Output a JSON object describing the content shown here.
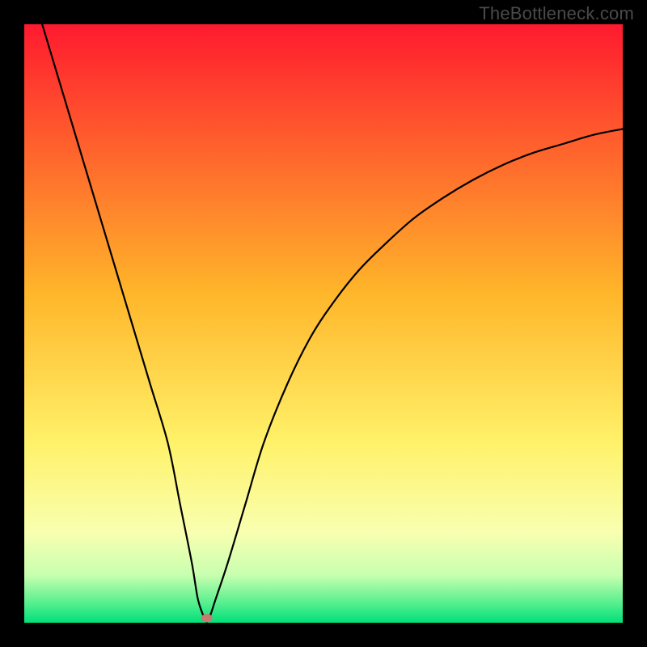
{
  "watermark": "TheBottleneck.com",
  "chart_data": {
    "type": "line",
    "title": "",
    "xlabel": "",
    "ylabel": "",
    "xlim": [
      0,
      100
    ],
    "ylim": [
      0,
      100
    ],
    "series": [
      {
        "name": "bottleneck-curve",
        "x": [
          3,
          6,
          9,
          12,
          15,
          18,
          21,
          24,
          26,
          28,
          29,
          30,
          30.5,
          31,
          32,
          34,
          37,
          40,
          44,
          48,
          52,
          56,
          60,
          65,
          70,
          75,
          80,
          85,
          90,
          95,
          100
        ],
        "y": [
          100,
          90,
          80,
          70,
          60,
          50,
          40,
          30,
          20,
          10,
          4,
          1,
          0.2,
          1,
          4,
          10,
          20,
          30,
          40,
          48,
          54,
          59,
          63,
          67.5,
          71,
          74,
          76.5,
          78.5,
          80,
          81.5,
          82.5
        ]
      }
    ],
    "marker": {
      "x": 30.5,
      "y": 0.8,
      "color": "#c97b6f"
    },
    "background_gradient_stops": [
      {
        "pos": 0.0,
        "color": "#ff1a2f"
      },
      {
        "pos": 0.45,
        "color": "#ffb62a"
      },
      {
        "pos": 0.7,
        "color": "#fff26a"
      },
      {
        "pos": 0.85,
        "color": "#f8ffb0"
      },
      {
        "pos": 0.92,
        "color": "#c8ffb0"
      },
      {
        "pos": 0.965,
        "color": "#5cf090"
      },
      {
        "pos": 1.0,
        "color": "#00e07a"
      }
    ]
  }
}
